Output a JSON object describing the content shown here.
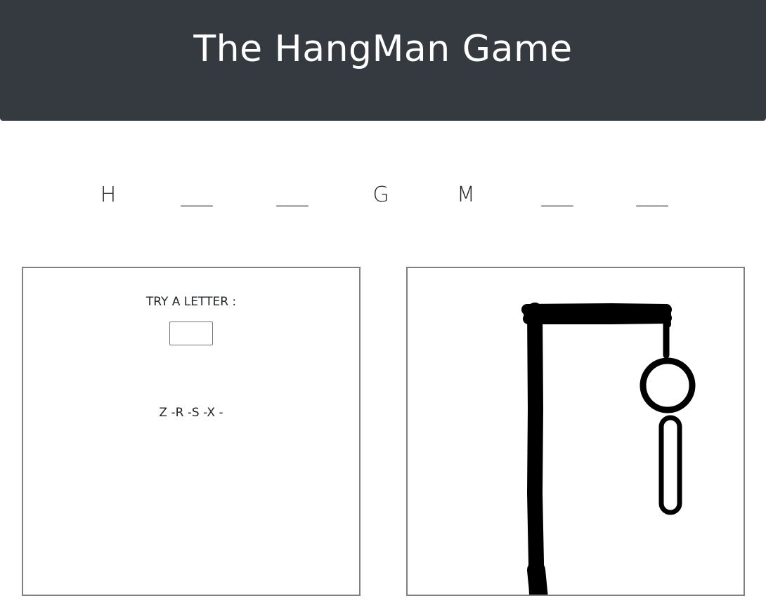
{
  "header": {
    "title": "The HangMan Game"
  },
  "word": {
    "slots": [
      "H",
      "___",
      "___",
      "G",
      "M",
      "___",
      "___"
    ]
  },
  "input_panel": {
    "try_label": "TRY A LETTER :",
    "letter_value": "",
    "wrong_letters": "Z -R -S -X -"
  },
  "drawing": {
    "parts_drawn": [
      "base-pole",
      "top-beam",
      "rope",
      "head",
      "body"
    ],
    "stroke_color": "#000000"
  },
  "colors": {
    "header_bg": "#343a40",
    "header_text": "#ffffff",
    "panel_border": "#808080"
  }
}
